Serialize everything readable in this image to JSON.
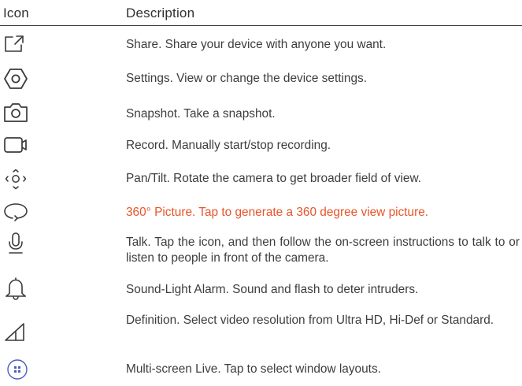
{
  "header": {
    "icon_label": "Icon",
    "description_label": "Description"
  },
  "rows": [
    {
      "icon": "share-icon",
      "text": "Share. Share your device with anyone you want.",
      "highlight": false
    },
    {
      "icon": "settings-icon",
      "text": "Settings. View or change the device settings.",
      "highlight": false
    },
    {
      "icon": "camera-icon",
      "text": "Snapshot. Take a snapshot.",
      "highlight": false
    },
    {
      "icon": "video-record-icon",
      "text": "Record. Manually start/stop recording.",
      "highlight": false
    },
    {
      "icon": "pan-tilt-icon",
      "text": "Pan/Tilt. Rotate the camera to get broader field of view.",
      "highlight": false
    },
    {
      "icon": "panorama-360-icon",
      "text": "360° Picture. Tap to generate a 360 degree view picture.",
      "highlight": true
    },
    {
      "icon": "microphone-icon",
      "text": "Talk. Tap the icon, and then follow the on-screen instructions to talk to or listen to people in front of the camera.",
      "highlight": false
    },
    {
      "icon": "bell-icon",
      "text": "Sound-Light Alarm. Sound and flash to deter intruders.",
      "highlight": false
    },
    {
      "icon": "definition-icon",
      "text": "Definition. Select video resolution from Ultra HD, Hi-Def or Standard.",
      "highlight": false
    },
    {
      "icon": "multi-screen-icon",
      "text": "Multi-screen Live. Tap to select window layouts.",
      "highlight": false
    }
  ],
  "colors": {
    "text": "#3d3d3d",
    "highlight": "#e8542a",
    "icon_stroke": "#3a3a3a",
    "multi_screen_icon": "#4a5fc1"
  }
}
